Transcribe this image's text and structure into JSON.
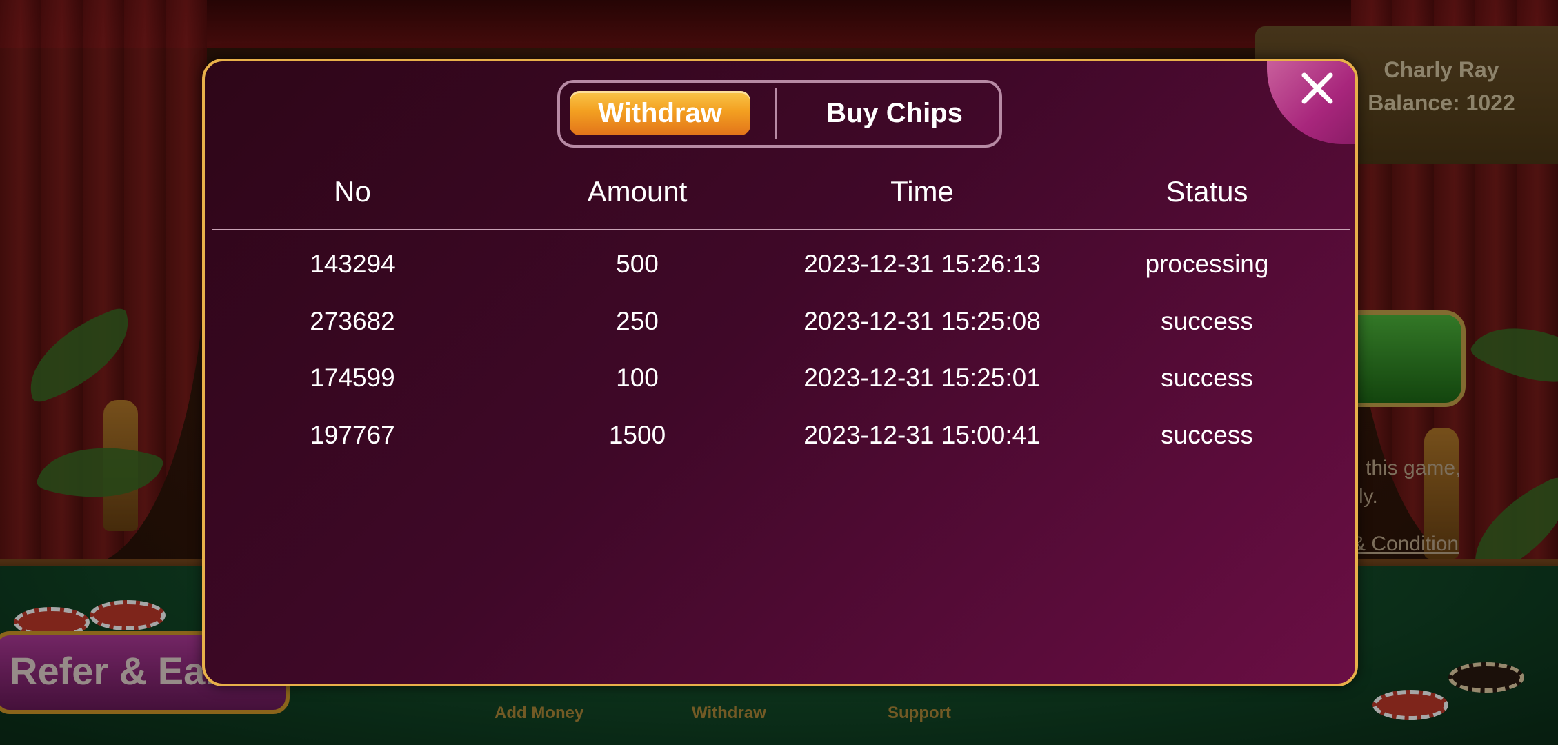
{
  "background": {
    "profile": {
      "name": "Charly Ray",
      "balance": "Balance: 1022"
    },
    "notice_line1": "this game,",
    "notice_line2": "ly.",
    "terms_link": "& Condition",
    "refer_button": "Refer & Earn",
    "bottom_nav": [
      {
        "label": "Add Money"
      },
      {
        "label": "Withdraw"
      },
      {
        "label": "Support"
      }
    ]
  },
  "modal": {
    "tabs": [
      {
        "label": "Withdraw",
        "active": true
      },
      {
        "label": "Buy Chips",
        "active": false
      }
    ],
    "columns": [
      "No",
      "Amount",
      "Time",
      "Status"
    ],
    "rows": [
      {
        "no": "143294",
        "amount": "500",
        "time": "2023-12-31 15:26:13",
        "status": "processing"
      },
      {
        "no": "273682",
        "amount": "250",
        "time": "2023-12-31 15:25:08",
        "status": "success"
      },
      {
        "no": "174599",
        "amount": "100",
        "time": "2023-12-31 15:25:01",
        "status": "success"
      },
      {
        "no": "197767",
        "amount": "1500",
        "time": "2023-12-31 15:00:41",
        "status": "success"
      }
    ],
    "close_icon": "close-icon"
  },
  "colors": {
    "modal_border": "#e8b04a",
    "active_tab": "#f3a021",
    "modal_bg": "#4a0a30"
  }
}
